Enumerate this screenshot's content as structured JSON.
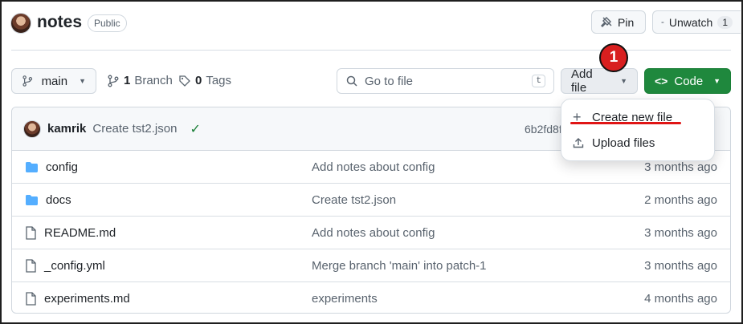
{
  "repo": {
    "name": "notes",
    "visibility": "Public",
    "pin_label": "Pin",
    "watch_label": "Unwatch",
    "watch_count": "1"
  },
  "toolbar": {
    "branch": "main",
    "branch_count": "1",
    "branch_word": "Branch",
    "tag_count": "0",
    "tag_word": "Tags",
    "search_placeholder": "Go to file",
    "search_shortcut": "t",
    "add_file_label": "Add file",
    "code_label": "Code"
  },
  "latest_commit": {
    "author": "kamrik",
    "message": "Create tst2.json",
    "hash": "6b2fd8f"
  },
  "files": [
    {
      "name": "config",
      "type": "folder",
      "message": "Add notes about config",
      "age": "3 months ago"
    },
    {
      "name": "docs",
      "type": "folder",
      "message": "Create tst2.json",
      "age": "2 months ago"
    },
    {
      "name": "README.md",
      "type": "file",
      "message": "Add notes about config",
      "age": "3 months ago"
    },
    {
      "name": "_config.yml",
      "type": "file",
      "message": "Merge branch 'main' into patch-1",
      "age": "3 months ago"
    },
    {
      "name": "experiments.md",
      "type": "file",
      "message": "experiments",
      "age": "4 months ago"
    }
  ],
  "add_file_menu": {
    "create_label": "Create new file",
    "upload_label": "Upload files"
  },
  "annotation": {
    "step_number": "1"
  },
  "colors": {
    "code_button": "#1f883d",
    "folder_icon": "#54aeff",
    "check": "#1a7f37",
    "annotation": "#d81f1f"
  }
}
